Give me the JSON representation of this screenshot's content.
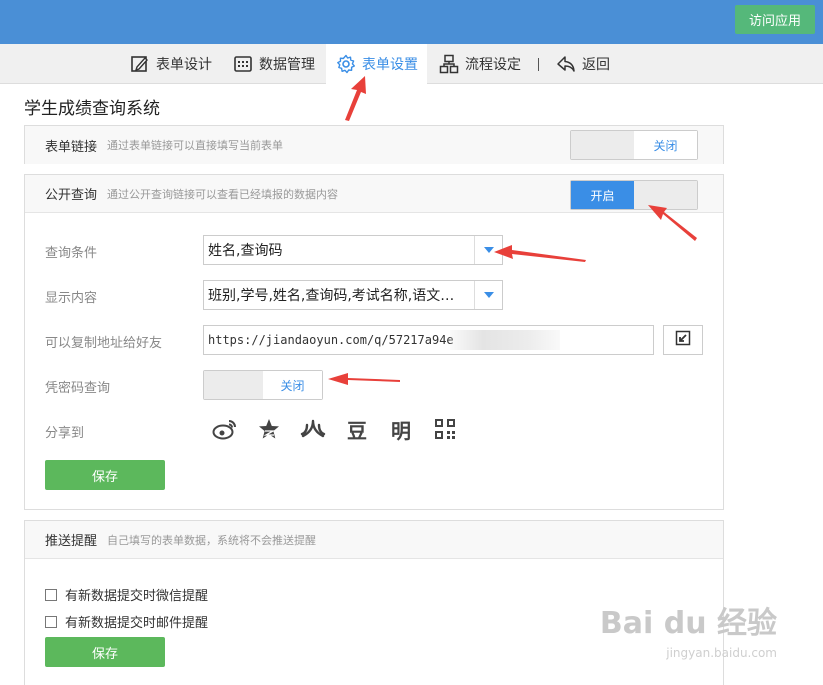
{
  "topbar": {
    "visit_label": "访问应用"
  },
  "nav": {
    "items": [
      {
        "label": "表单设计",
        "icon": "edit-icon"
      },
      {
        "label": "数据管理",
        "icon": "table-icon"
      },
      {
        "label": "表单设置",
        "icon": "gear-icon"
      },
      {
        "label": "流程设定",
        "icon": "flow-icon"
      },
      {
        "label": "返回",
        "icon": "back-icon"
      }
    ],
    "active": "表单设置"
  },
  "page_title": "学生成绩查询系统",
  "form_link": {
    "title": "表单链接",
    "desc": "通过表单链接可以直接填写当前表单",
    "toggle_label": "关闭",
    "toggle_state": "off"
  },
  "public_query": {
    "title": "公开查询",
    "desc": "通过公开查询链接可以查看已经填报的数据内容",
    "toggle_label": "开启",
    "toggle_state": "on",
    "query_condition": {
      "label": "查询条件",
      "value": "姓名,查询码"
    },
    "display_content": {
      "label": "显示内容",
      "value": "班别,学号,姓名,查询码,考试名称,语文…"
    },
    "copy_link": {
      "label": "可以复制地址给好友",
      "value": "https://jiandaoyun.com/q/57217a94e"
    },
    "password_query": {
      "label": "凭密码查询",
      "toggle_label": "关闭",
      "toggle_state": "off"
    },
    "share": {
      "label": "分享到",
      "icons": [
        "weibo-icon",
        "qzone-icon",
        "renren-icon",
        "douban-icon",
        "ming-icon",
        "qrcode-icon"
      ],
      "glyphs": [
        "豆",
        "明"
      ]
    },
    "save_label": "保存"
  },
  "push": {
    "title": "推送提醒",
    "desc": "自己填写的表单数据，系统将不会推送提醒",
    "options": [
      {
        "label": "有新数据提交时微信提醒",
        "checked": false
      },
      {
        "label": "有新数据提交时邮件提醒",
        "checked": false
      }
    ],
    "save_label": "保存"
  },
  "watermark": {
    "main": "Bai du 经验",
    "sub": "jingyan.baidu.com"
  },
  "colors": {
    "topbar": "#4a8fd6",
    "accent": "#3a8ee6",
    "green": "#5cb85c",
    "arrow": "#e8403a"
  }
}
